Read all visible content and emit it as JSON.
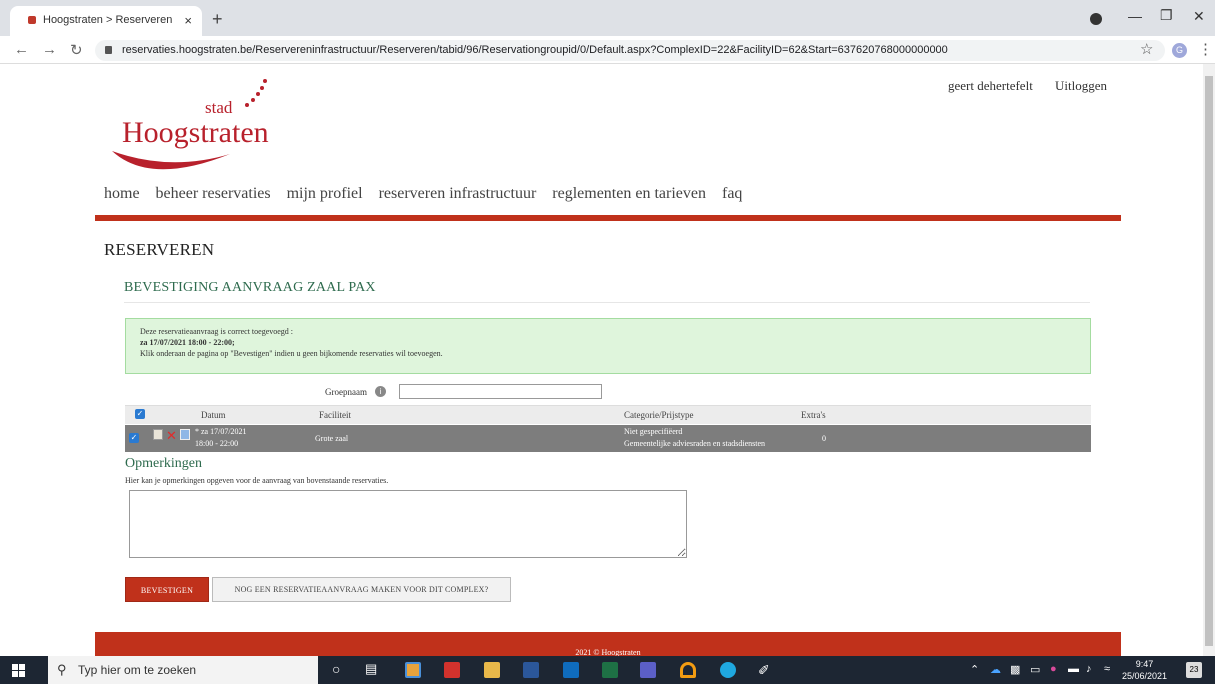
{
  "browser": {
    "tab_title": "Hoogstraten > Reserveren infras",
    "tab_close": "×",
    "new_tab": "+",
    "url": "reservaties.hoogstraten.be/Reservereninfrastructuur/Reserveren/tabid/96/Reservationgroupid/0/Default.aspx?ComplexID=22&FacilityID=62&Start=637620768000000000",
    "profile_initial": "G",
    "icons": [
      "back-arrow-icon",
      "forward-arrow-icon",
      "reload-icon",
      "lock-icon",
      "star-icon",
      "kebab-menu-icon"
    ]
  },
  "header": {
    "logo_stad": "stad",
    "logo_name": "Hoogstraten",
    "user_name": "geert dehertefelt",
    "logout": "Uitloggen"
  },
  "nav": {
    "items": [
      "home",
      "beheer reservaties",
      "mijn profiel",
      "reserveren infrastructuur",
      "reglementen en tarieven",
      "faq"
    ]
  },
  "page": {
    "heading": "RESERVEREN",
    "subheading": "BEVESTIGING AANVRAAG ZAAL PAX"
  },
  "alert": {
    "line1": "Deze reservatieaanvraag is correct toegevoegd :",
    "line2": "za 17/07/2021 18:00 - 22:00;",
    "line3": "Klik onderaan de pagina op \"Bevestigen\" indien u geen bijkomende reservaties wil toevoegen."
  },
  "group": {
    "label": "Groepnaam",
    "info": "i",
    "value": ""
  },
  "table": {
    "headers": [
      "Datum",
      "Faciliteit",
      "Categorie/Prijstype",
      "Extra's"
    ],
    "row": {
      "date": "* za 17/07/2021",
      "time": "18:00 - 22:00",
      "facility": "Grote zaal",
      "category_line1": "Niet gespecifiëerd",
      "category_line2": "Gemeentelijke adviesraden en stadsdiensten",
      "extras": "0"
    }
  },
  "remarks": {
    "title": "Opmerkingen",
    "help": "Hier kan je opmerkingen opgeven voor de aanvraag van bovenstaande reservaties.",
    "value": ""
  },
  "buttons": {
    "confirm": "BEVESTIGEN",
    "another": "NOG EEN RESERVATIEAANVRAAG MAKEN VOOR DIT COMPLEX?"
  },
  "footer": {
    "text": "2021 © Hoogstraten"
  },
  "taskbar": {
    "search_placeholder": "Typ hier om te zoeken",
    "time": "9:47",
    "date": "25/06/2021",
    "notifications": "23",
    "colors": {
      "accent_red": "#c0311b",
      "heading_green": "#2e6b4e",
      "alert_green": "#dff5dc"
    }
  }
}
